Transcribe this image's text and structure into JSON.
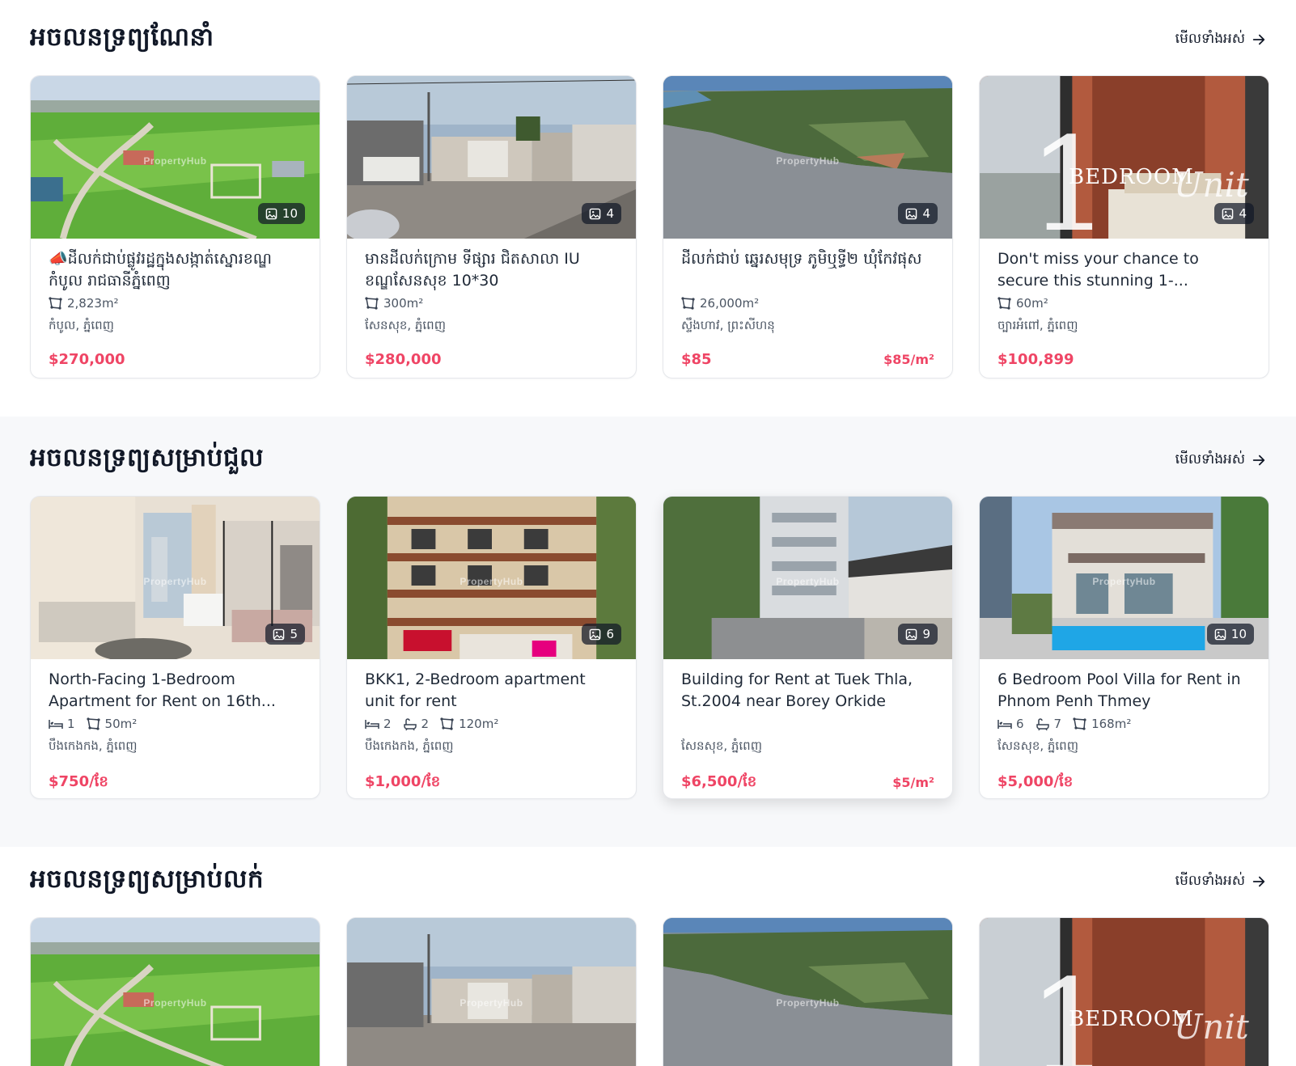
{
  "sections": [
    {
      "title": "អចលនទ្រព្យណែនាំ",
      "see_all": "មើលទាំងអស់",
      "cards": [
        {
          "title": "📣ដីលក់ជាប់ផ្លូវរដ្ឋក្នុងសង្កាត់ស្នោរខណ្ឌកំបូល រាជធានីភ្នំពេញ",
          "image_count": "10",
          "area": "2,823m²",
          "location": "កំបូល, ភ្នំពេញ",
          "price": "$270,000",
          "price_per_m2": ""
        },
        {
          "title": "មានដីលក់ក្រោម ទីផ្សារ ជិតសាលា IU ខណ្ឌសែនសុខ 10*30",
          "image_count": "4",
          "area": "300m²",
          "location": "សែនសុខ, ភ្នំពេញ",
          "price": "$280,000",
          "price_per_m2": ""
        },
        {
          "title": "ដីលក់ជាប់ ឆ្នេរសមុទ្រ ភូមិឬទ្ធី២ ឃុំកែវផុស",
          "image_count": "4",
          "area": "26,000m²",
          "location": "ស្ទឹងហាវ, ព្រះសីហនុ",
          "price": "$85",
          "price_per_m2": "$85/m²"
        },
        {
          "title": "Don't miss your chance to secure this stunning 1-...",
          "image_count": "4",
          "area": "60m²",
          "location": "ច្បារអំពៅ, ភ្នំពេញ",
          "price": "$100,899",
          "price_per_m2": ""
        }
      ]
    },
    {
      "title": "អចលនទ្រព្យសម្រាប់ជួល",
      "see_all": "មើលទាំងអស់",
      "cards": [
        {
          "title": "North-Facing 1-Bedroom Apartment for Rent on 16th...",
          "image_count": "5",
          "beds": "1",
          "baths": "",
          "area": "50m²",
          "location": "បឹងកេងកង, ភ្នំពេញ",
          "price": "$750/ខែ",
          "price_per_m2": ""
        },
        {
          "title": "BKK1, 2-Bedroom apartment unit for rent",
          "image_count": "6",
          "beds": "2",
          "baths": "2",
          "area": "120m²",
          "location": "បឹងកេងកង, ភ្នំពេញ",
          "price": "$1,000/ខែ",
          "price_per_m2": ""
        },
        {
          "title": "Building for Rent at Tuek Thla, St.2004 near Borey Orkide",
          "image_count": "9",
          "beds": "",
          "baths": "",
          "area": "",
          "location": "សែនសុខ, ភ្នំពេញ",
          "price": "$6,500/ខែ",
          "price_per_m2": "$5/m²"
        },
        {
          "title": "6 Bedroom Pool Villa for Rent in Phnom Penh Thmey",
          "image_count": "10",
          "beds": "6",
          "baths": "7",
          "area": "168m²",
          "location": "សែនសុខ, ភ្នំពេញ",
          "price": "$5,000/ខែ",
          "price_per_m2": ""
        }
      ]
    },
    {
      "title": "អចលនទ្រព្យសម្រាប់លក់",
      "see_all": "មើលទាំងអស់"
    }
  ],
  "watermark": "PropertyHub",
  "promo": {
    "big_number": "1",
    "bedroom": "BEDROOM",
    "unit": "Unit"
  },
  "colors": {
    "price": "#ef4565",
    "heading": "#111827",
    "section_alt_bg": "#f7f8fa"
  },
  "icons": {
    "area": "area-icon",
    "bed": "bed-icon",
    "bath": "bath-icon",
    "gallery": "image-icon",
    "arrow": "arrow-right-icon"
  }
}
